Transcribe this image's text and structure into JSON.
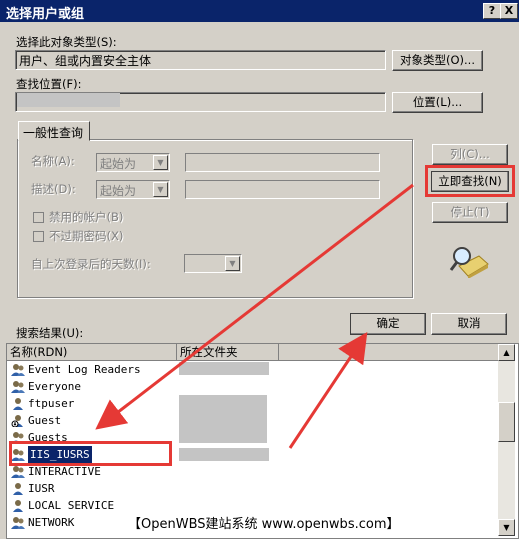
{
  "window": {
    "title": "选择用户或组",
    "help_btn": "?",
    "close_btn": "X"
  },
  "object_type": {
    "label": "选择此对象类型(S):",
    "value": "用户、组或内置安全主体",
    "button": "对象类型(O)..."
  },
  "location": {
    "label": "查找位置(F):",
    "value": "",
    "button": "位置(L)..."
  },
  "query": {
    "tab": "一般性查询",
    "name_label": "名称(A):",
    "name_mode": "起始为",
    "desc_label": "描述(D):",
    "desc_mode": "起始为",
    "disabled_accounts": "禁用的帐户(B)",
    "non_expiring": "不过期密码(X)",
    "days_label": "自上次登录后的天数(I):"
  },
  "side_buttons": {
    "columns": "列(C)...",
    "find_now": "立即查找(N)",
    "stop": "停止(T)"
  },
  "results": {
    "label": "搜索结果(U):",
    "ok": "确定",
    "cancel": "取消",
    "columns": [
      "名称(RDN)",
      "所在文件夹"
    ],
    "rows": [
      {
        "name": "Event Log Readers",
        "icon": "group-icon"
      },
      {
        "name": "Everyone",
        "icon": "group-icon"
      },
      {
        "name": "ftpuser",
        "icon": "user-icon"
      },
      {
        "name": "Guest",
        "icon": "disabled-user-icon"
      },
      {
        "name": "Guests",
        "icon": "group-icon"
      },
      {
        "name": "IIS_IUSRS",
        "icon": "group-icon",
        "selected": true
      },
      {
        "name": "INTERACTIVE",
        "icon": "group-icon"
      },
      {
        "name": "IUSR",
        "icon": "user-icon"
      },
      {
        "name": "LOCAL SERVICE",
        "icon": "user-icon"
      },
      {
        "name": "NETWORK",
        "icon": "group-icon"
      }
    ]
  },
  "watermark": "【OpenWBS建站系统 www.openwbs.com】",
  "colors": {
    "annotation_red": "#e53935",
    "selection": "#0a246a",
    "titlebar": "#0a246a"
  }
}
